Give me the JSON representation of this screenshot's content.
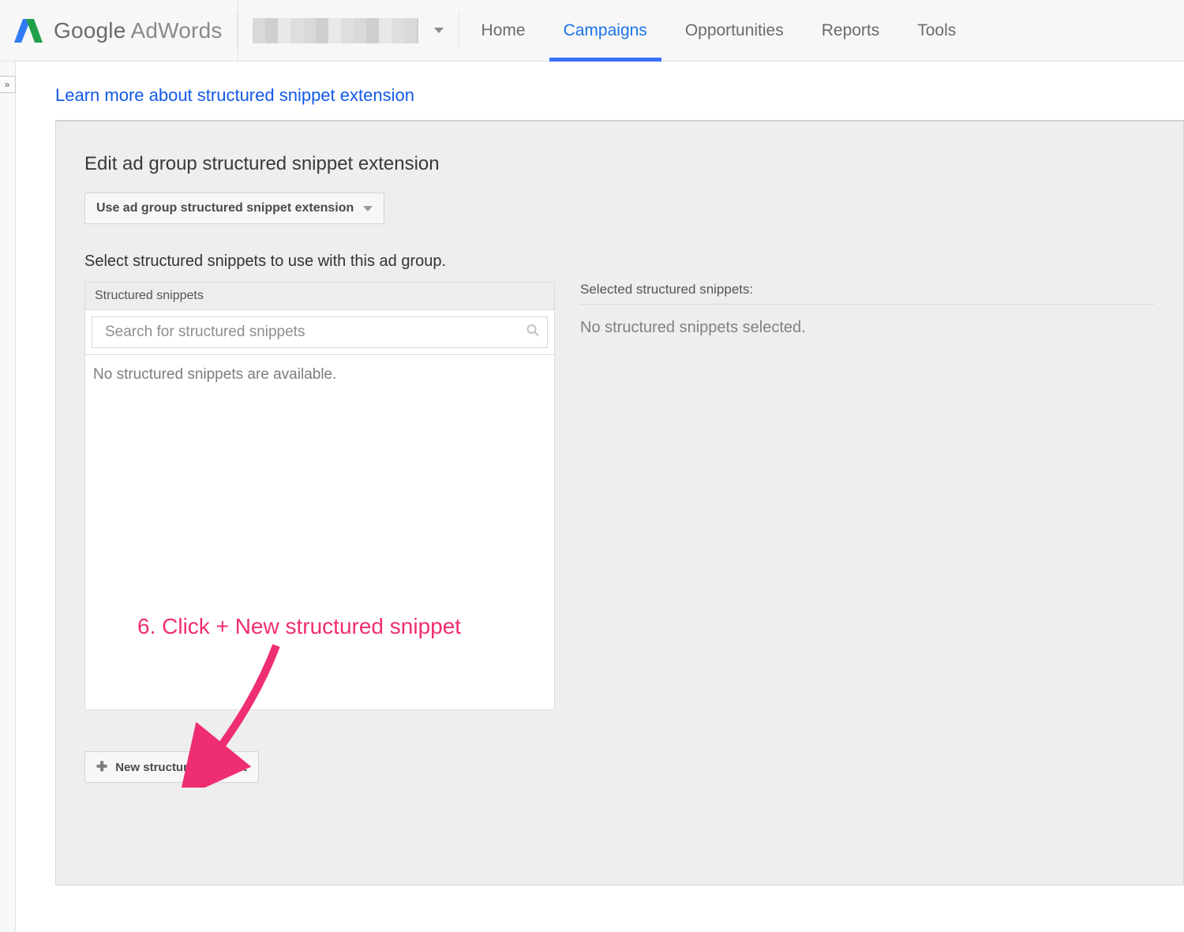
{
  "header": {
    "brand_google": "Google",
    "brand_adwords": "AdWords",
    "nav": {
      "home": "Home",
      "campaigns": "Campaigns",
      "opportunities": "Opportunities",
      "reports": "Reports",
      "tools": "Tools"
    }
  },
  "drawer_toggle_glyph": "»",
  "learn_more": "Learn more about structured snippet extension",
  "panel": {
    "heading": "Edit ad group structured snippet extension",
    "level_dropdown": "Use ad group structured snippet extension",
    "instruction": "Select structured snippets to use with this ad group.",
    "picker_header": "Structured snippets",
    "search_placeholder": "Search for structured snippets",
    "empty_available": "No structured snippets are available.",
    "selected_header": "Selected structured snippets:",
    "empty_selected": "No structured snippets selected.",
    "new_button": "New structured snippet"
  },
  "annotation": {
    "text": "6. Click + New structured snippet"
  }
}
